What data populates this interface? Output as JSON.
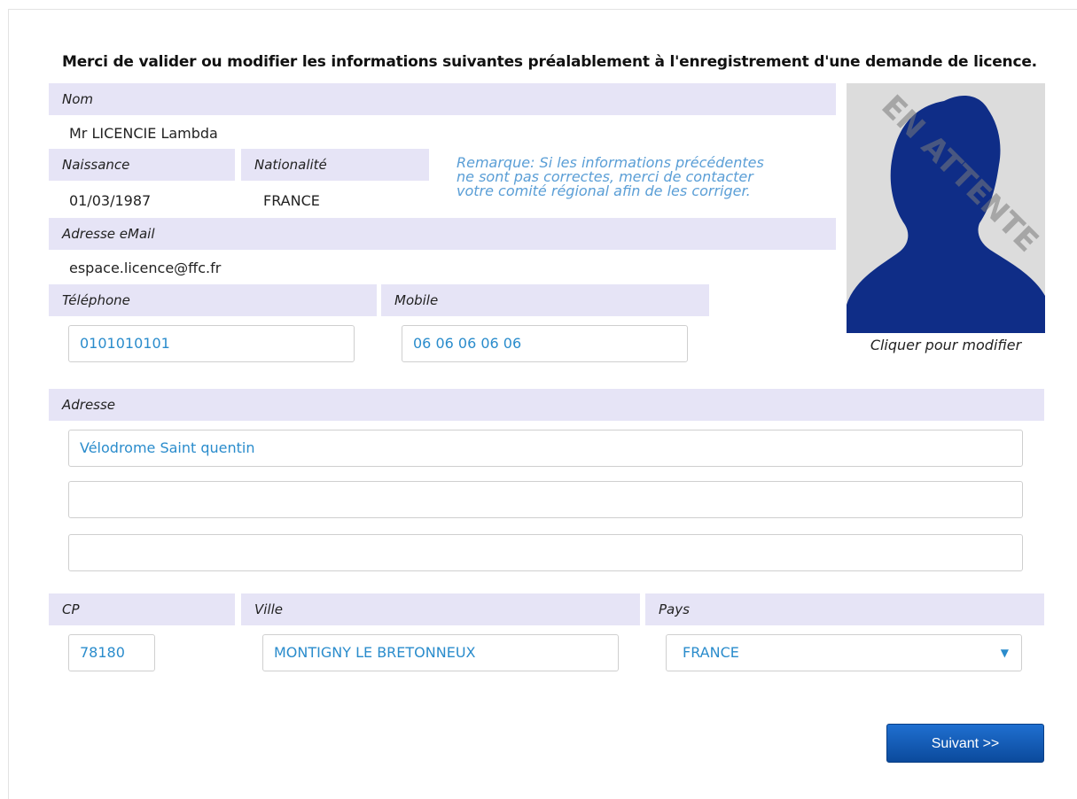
{
  "intro": "Merci de valider ou modifier les informations suivantes préalablement à l'enregistrement d'une demande de licence.",
  "fields": {
    "nom_label": "Nom",
    "nom_value": "Mr LICENCIE Lambda",
    "naissance_label": "Naissance",
    "naissance_value": "01/03/1987",
    "nationalite_label": "Nationalité",
    "nationalite_value": "FRANCE",
    "email_label": "Adresse eMail",
    "email_value": "espace.licence@ffc.fr",
    "telephone_label": "Téléphone",
    "telephone_value": "0101010101",
    "mobile_label": "Mobile",
    "mobile_value": "06 06 06 06 06",
    "adresse_label": "Adresse",
    "adresse_line1": "Vélodrome Saint quentin",
    "adresse_line2": "",
    "adresse_line3": "",
    "cp_label": "CP",
    "cp_value": "78180",
    "ville_label": "Ville",
    "ville_value": "MONTIGNY LE BRETONNEUX",
    "pays_label": "Pays",
    "pays_value": "FRANCE"
  },
  "remark": {
    "line1": "Remarque: Si les informations précédentes",
    "line2": "ne sont pas correctes, merci de contacter",
    "line3": "votre comité régional afin de les corriger."
  },
  "photo": {
    "watermark": "EN ATTENTE",
    "caption": "Cliquer pour modifier",
    "bg_color": "#dcdcdc",
    "silhouette_color": "#0f2d87"
  },
  "actions": {
    "next_label": "Suivant >>"
  },
  "colors": {
    "band": "#e6e4f6",
    "input_text": "#2a8ccc",
    "remark_text": "#5a9ed6",
    "button": "#1760be"
  }
}
